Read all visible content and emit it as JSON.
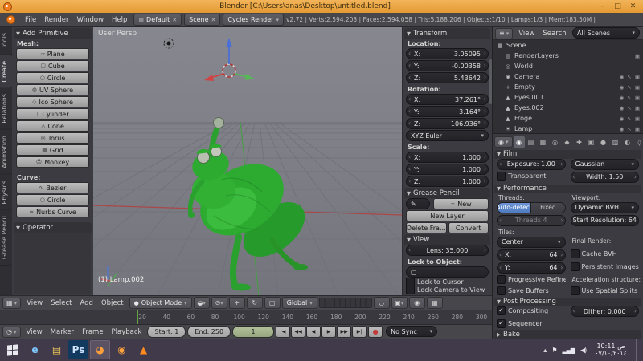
{
  "icons": {
    "dropdown": "▾",
    "panel_open": "▼",
    "panel_closed": "▶",
    "check": "✓",
    "close_x": "✕",
    "plus": "+",
    "pencil": "✎",
    "record": "●",
    "view3d_editor": "▦",
    "timeline_editor": "◔",
    "outliner_editor": "≡",
    "mode_sphere": "●",
    "shading_sphere": "◒",
    "pivot": "⊙",
    "rotate": "↻",
    "scale_box": "▢",
    "magnet": "◡",
    "snap_element": "▣",
    "render_camera": "◉",
    "render_anim": "▦",
    "object_field": "▢"
  },
  "titlebar": {
    "title": "Blender [C:\\Users\\anas\\Desktop\\untitled.blend]",
    "minimize": "–",
    "maximize": "□",
    "close": "✕"
  },
  "infobar": {
    "menus": [
      "File",
      "Render",
      "Window",
      "Help"
    ],
    "layout": "Default",
    "scene": "Scene",
    "engine": "Cycles Render",
    "stats": "v2.72 | Verts:2,594,203 | Faces:2,594,058 | Tris:5,188,206 | Objects:1/10 | Lamps:1/3 | Mem:183.50M |"
  },
  "toolshelf": {
    "tabs": [
      {
        "label": "Tools"
      },
      {
        "label": "Create",
        "active": true
      },
      {
        "label": "Relations"
      },
      {
        "label": "Animation"
      },
      {
        "label": "Physics"
      },
      {
        "label": "Grease Pencil"
      }
    ],
    "panel_title": "Add Primitive",
    "mesh_label": "Mesh:",
    "mesh_buttons": [
      {
        "icon": "▱",
        "label": "Plane"
      },
      {
        "icon": "▢",
        "label": "Cube"
      },
      {
        "icon": "○",
        "label": "Circle"
      },
      {
        "icon": "◍",
        "label": "UV Sphere"
      },
      {
        "icon": "◇",
        "label": "Ico Sphere"
      },
      {
        "icon": "▯",
        "label": "Cylinder"
      },
      {
        "icon": "△",
        "label": "Cone"
      },
      {
        "icon": "◎",
        "label": "Torus"
      },
      {
        "icon": "▦",
        "label": "Grid"
      },
      {
        "icon": "☺",
        "label": "Monkey"
      }
    ],
    "curve_label": "Curve:",
    "curve_buttons": [
      {
        "icon": "∿",
        "label": "Bezier"
      },
      {
        "icon": "○",
        "label": "Circle"
      },
      {
        "icon": "≈",
        "label": "Nurbs Curve"
      }
    ],
    "operator_title": "Operator"
  },
  "viewport": {
    "view_label": "User Persp",
    "active_object": "(1) Lamp.002",
    "model_color": "#2dab31",
    "background_color": "#7f7f87"
  },
  "npanel": {
    "transform_title": "Transform",
    "location_label": "Location:",
    "location": [
      {
        "k": "X:",
        "v": "3.05095"
      },
      {
        "k": "Y:",
        "v": "-0.00358"
      },
      {
        "k": "Z:",
        "v": "5.43642"
      }
    ],
    "rotation_label": "Rotation:",
    "rotation": [
      {
        "k": "X:",
        "v": "37.261°"
      },
      {
        "k": "Y:",
        "v": "3.164°"
      },
      {
        "k": "Z:",
        "v": "106.936°"
      }
    ],
    "rotation_mode": "XYZ Euler",
    "scale_label": "Scale:",
    "scale": [
      {
        "k": "X:",
        "v": "1.000"
      },
      {
        "k": "Y:",
        "v": "1.000"
      },
      {
        "k": "Z:",
        "v": "1.000"
      }
    ],
    "grease_title": "Grease Pencil",
    "gp_new": "New",
    "gp_new_layer": "New Layer",
    "gp_delete": "Delete Fra...",
    "gp_convert": "Convert",
    "view_title": "View",
    "lens": "Lens: 35.000",
    "lock_object_label": "Lock to Object:",
    "lock_cursor": "Lock to Cursor",
    "lock_camera": "Lock Camera to View"
  },
  "outliner": {
    "menus": [
      "View",
      "Search"
    ],
    "scope": "All Scenes",
    "items": [
      {
        "icon": "▦",
        "label": "Scene",
        "depth": 0,
        "r": ""
      },
      {
        "icon": "▤",
        "label": "RenderLayers",
        "depth": 1,
        "r": "▣"
      },
      {
        "icon": "◎",
        "label": "World",
        "depth": 1,
        "r": ""
      },
      {
        "icon": "◉",
        "label": "Camera",
        "depth": 1,
        "r": "◉ ↖ ▣"
      },
      {
        "icon": "+",
        "label": "Empty",
        "depth": 1,
        "r": "◉ ↖ ▣"
      },
      {
        "icon": "▲",
        "label": "Eyes.001",
        "depth": 1,
        "r": "◉ ↖ ▣"
      },
      {
        "icon": "▲",
        "label": "Eyes.002",
        "depth": 1,
        "r": "◉ ↖ ▣"
      },
      {
        "icon": "▲",
        "label": "Froge",
        "depth": 1,
        "r": "◉ ↖ ▣"
      },
      {
        "icon": "☀",
        "label": "Lamp",
        "depth": 1,
        "r": "◉ ↖ ▣"
      }
    ]
  },
  "properties": {
    "tabs": [
      {
        "glyph": "◉",
        "name": "render-tab-icon",
        "active": true
      },
      {
        "glyph": "▤",
        "name": "render-layers-tab-icon"
      },
      {
        "glyph": "▦",
        "name": "scene-tab-icon"
      },
      {
        "glyph": "◎",
        "name": "world-tab-icon"
      },
      {
        "glyph": "◆",
        "name": "object-tab-icon"
      },
      {
        "glyph": "✚",
        "name": "constraints-tab-icon"
      },
      {
        "glyph": "▣",
        "name": "modifiers-tab-icon"
      },
      {
        "glyph": "●",
        "name": "data-tab-icon"
      },
      {
        "glyph": "▨",
        "name": "material-tab-icon"
      },
      {
        "glyph": "◐",
        "name": "texture-tab-icon"
      },
      {
        "glyph": "◊",
        "name": "physics-tab-icon"
      }
    ],
    "film": {
      "title": "Film",
      "exposure": "Exposure: 1.00",
      "filter": "Gaussian",
      "transparent_label": "Transparent",
      "width": "Width: 1.50"
    },
    "performance": {
      "title": "Performance",
      "threads_label": "Threads:",
      "viewport_label": "Viewport:",
      "autodetect": "Auto-detect",
      "fixed": "Fixed",
      "viewport_bvh": "Dynamic BVH",
      "threads_value": "Threads 4",
      "start_resolution": "Start Resolution: 64",
      "tiles_label": "Tiles:",
      "tile_order": "Center",
      "final_render_label": "Final Render:",
      "tile_x_label": "X:",
      "tile_x": "64",
      "tile_y_label": "Y:",
      "tile_y": "64",
      "progressive_refine": "Progressive Refine",
      "save_buffers": "Save Buffers",
      "cache_bvh": "Cache BVH",
      "persistent_images": "Persistent Images",
      "accel_label": "Acceleration structure:",
      "spatial_splits": "Use Spatial Splits"
    },
    "post": {
      "title": "Post Processing",
      "compositing": "Compositing",
      "sequencer": "Sequencer",
      "dither": "Dither: 0.000"
    },
    "bake_title": "Bake"
  },
  "view3d_header": {
    "menus": [
      "View",
      "Select",
      "Add",
      "Object"
    ],
    "mode": "Object Mode",
    "orientation": "Global"
  },
  "timeline": {
    "ruler": [
      "20",
      "40",
      "60",
      "80",
      "100",
      "120",
      "140",
      "160",
      "180",
      "200",
      "220",
      "240",
      "260",
      "280",
      "300"
    ],
    "menus": [
      "View",
      "Marker",
      "Frame",
      "Playback"
    ],
    "start": "Start: 1",
    "end": "End: 250",
    "frame": "1",
    "media": [
      {
        "name": "jump-to-start-button",
        "glyph": "|◀"
      },
      {
        "name": "prev-keyframe-button",
        "glyph": "◀◀"
      },
      {
        "name": "play-reverse-button",
        "glyph": "◀"
      },
      {
        "name": "play-button",
        "glyph": "▶"
      },
      {
        "name": "next-keyframe-button",
        "glyph": "▶▶"
      },
      {
        "name": "jump-to-end-button",
        "glyph": "▶|"
      }
    ],
    "sync": "No Sync"
  },
  "taskbar": {
    "icons": [
      {
        "name": "internet-explorer-icon",
        "glyph": "e",
        "fg": "#7ec7ff"
      },
      {
        "name": "file-explorer-icon",
        "glyph": "▤",
        "fg": "#f0c75a"
      },
      {
        "name": "photoshop-icon",
        "glyph": "Ps",
        "fg": "#cfe3ff",
        "bg": "#123a5e"
      },
      {
        "name": "blender-taskbar-icon",
        "glyph": "◕",
        "fg": "#ff9f3c",
        "active": true
      },
      {
        "name": "firefox-icon",
        "glyph": "◉",
        "fg": "#ffa13e"
      },
      {
        "name": "vlc-icon",
        "glyph": "▲",
        "fg": "#ff8a1e"
      }
    ],
    "tray": [
      {
        "name": "tray-chevron-icon",
        "glyph": "▴"
      },
      {
        "name": "action-center-icon",
        "glyph": "⚑"
      },
      {
        "name": "network-icon",
        "glyph": "▂▄▆"
      },
      {
        "name": "volume-icon",
        "glyph": "◀)"
      }
    ],
    "time": "10:11 ص",
    "date": "٠٧/١٠/٢٠١٤"
  }
}
